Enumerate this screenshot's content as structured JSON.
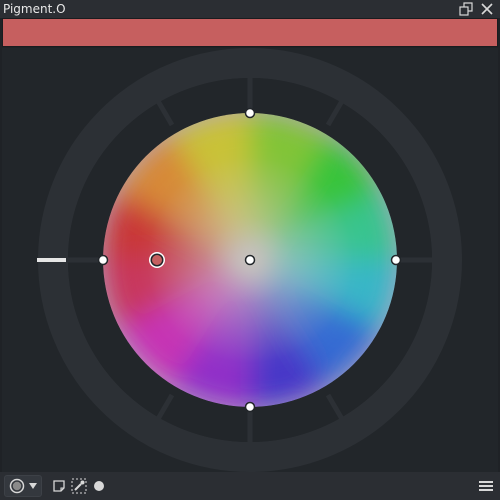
{
  "window": {
    "title": "Pigment.O"
  },
  "titlebar_icons": [
    "float-window-icon",
    "close-icon"
  ],
  "current_color": {
    "hex": "#c65f5f"
  },
  "colors": {
    "background": "#22262a",
    "ring": "#2c3035",
    "ring_divider": "#22262a",
    "indicator_line": "#e6e6e6"
  },
  "wheel": {
    "type": "hue-saturation wheel",
    "selected_hue_deg": 0,
    "selected_saturation": 0.64
  },
  "bottom_toolbar": {
    "icons": [
      "color-wheel-mode-icon",
      "dropdown-arrow-icon",
      "note-icon",
      "color-picker-icon",
      "dot-icon",
      "hamburger-menu-icon"
    ]
  }
}
